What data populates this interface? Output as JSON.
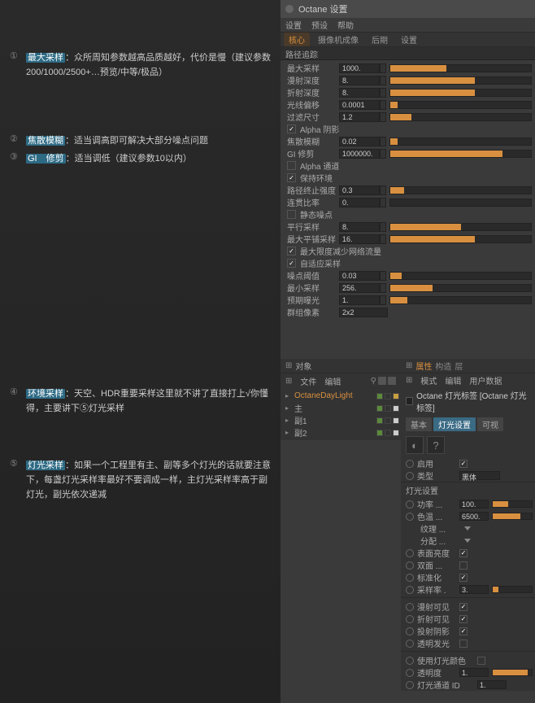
{
  "notes": [
    {
      "num": "①",
      "term": "最大采样",
      "text": "：众所周知参数越高品质越好，代价是慢（建议参数200/1000/2500+…预览/中等/极品）"
    },
    {
      "num": "②",
      "term": "焦散模糊",
      "text": "：适当调高即可解决大部分噪点问题"
    },
    {
      "num": "③",
      "term": "GI　修剪",
      "text": "：适当调低（建议参数10以内）"
    },
    {
      "num": "④",
      "term": "环境采样",
      "text": "：天空、HDR重要采样这里就不讲了直接打上√你懂得，主要讲下⑤灯光采样"
    },
    {
      "num": "⑤",
      "term": "灯光采样",
      "text": "：如果一个工程里有主、副等多个灯光的话就要注意下，每盏灯光采样率最好不要调成一样，主灯光采样率高于副灯光，副光依次递减"
    }
  ],
  "app": {
    "title": "Octane 设置",
    "menus": [
      "设置",
      "预设",
      "帮助"
    ],
    "tabs": [
      "核心",
      "摄像机成像",
      "后期",
      "设置"
    ]
  },
  "section1": "路径追踪",
  "params1": [
    {
      "l": "最大采样",
      "v": "1000.",
      "f": 40
    },
    {
      "l": "漫射深度",
      "v": "8.",
      "f": 60
    },
    {
      "l": "折射深度",
      "v": "8.",
      "f": 60
    },
    {
      "l": "光线偏移",
      "v": "0.0001",
      "f": 5
    },
    {
      "l": "过滤尺寸",
      "v": "1.2",
      "f": 15
    }
  ],
  "check1": "Alpha 阴影",
  "params1b": [
    {
      "l": "焦散模糊",
      "v": "0.02",
      "f": 5
    },
    {
      "l": "GI 修剪",
      "v": "1000000.",
      "f": 80
    }
  ],
  "checks2": [
    "Alpha 通道",
    "保持环境"
  ],
  "params2": [
    {
      "l": "路径终止强度",
      "v": "0.3",
      "f": 10
    },
    {
      "l": "连贯比率",
      "v": "0.",
      "f": 0
    }
  ],
  "check3": "静态噪点",
  "params3": [
    {
      "l": "平行采样",
      "v": "8.",
      "f": 50
    },
    {
      "l": "最大平铺采样",
      "v": "16.",
      "f": 60
    }
  ],
  "checks4": [
    "最大限度减少网络流量",
    "自适应采样"
  ],
  "params4": [
    {
      "l": "噪点阈值",
      "v": "0.03",
      "f": 8
    },
    {
      "l": "最小采样",
      "v": "256.",
      "f": 30
    },
    {
      "l": "预期曝光",
      "v": "1.",
      "f": 12
    }
  ],
  "param_sel": {
    "l": "群组像素",
    "v": "2x2"
  },
  "obj": {
    "hdr": "对象",
    "menus": [
      "文件",
      "编辑"
    ],
    "items": [
      {
        "nm": "OctaneDayLight",
        "cls": "orange",
        "tw": "▸"
      },
      {
        "nm": "主",
        "tw": "▸"
      },
      {
        "nm": "副1",
        "tw": "▸"
      },
      {
        "nm": "副2",
        "tw": "▸"
      }
    ]
  },
  "attr": {
    "hdr": "属性",
    "hdrL": [
      "构造",
      "层"
    ],
    "menus": [
      "模式",
      "编辑",
      "用户数据"
    ],
    "title": "Octane 灯光标签 [Octane 灯光标签]",
    "tabs": [
      "基本",
      "灯光设置",
      "可视"
    ],
    "r_enable": "启用",
    "r_type": "类型",
    "r_type_v": "黑体",
    "sect1": "灯光设置",
    "rows1": [
      {
        "l": "功率 ...",
        "v": "100.",
        "f": 40
      },
      {
        "l": "色温 ...",
        "v": "6500.",
        "f": 70
      }
    ],
    "rows1b": [
      {
        "l": "纹理 ..."
      },
      {
        "l": "分配 ..."
      }
    ],
    "rows2": [
      {
        "l": "表面亮度",
        "c": true
      },
      {
        "l": "双面 ...",
        "c": false
      },
      {
        "l": "标准化",
        "c": true
      }
    ],
    "r_sample": {
      "l": "采样率 .",
      "v": "3.",
      "f": 15
    },
    "rows3": [
      {
        "l": "漫射可见",
        "c": true
      },
      {
        "l": "折射可见",
        "c": true
      },
      {
        "l": "投射阴影",
        "c": true
      },
      {
        "l": "透明发光",
        "c": false
      }
    ],
    "rows4": [
      {
        "l": "使用灯光颜色",
        "c": false
      }
    ],
    "r_opacity": {
      "l": "透明度",
      "v": "1.",
      "f": 90
    },
    "r_pass": {
      "l": "灯光通道 ID",
      "v": "1."
    }
  }
}
